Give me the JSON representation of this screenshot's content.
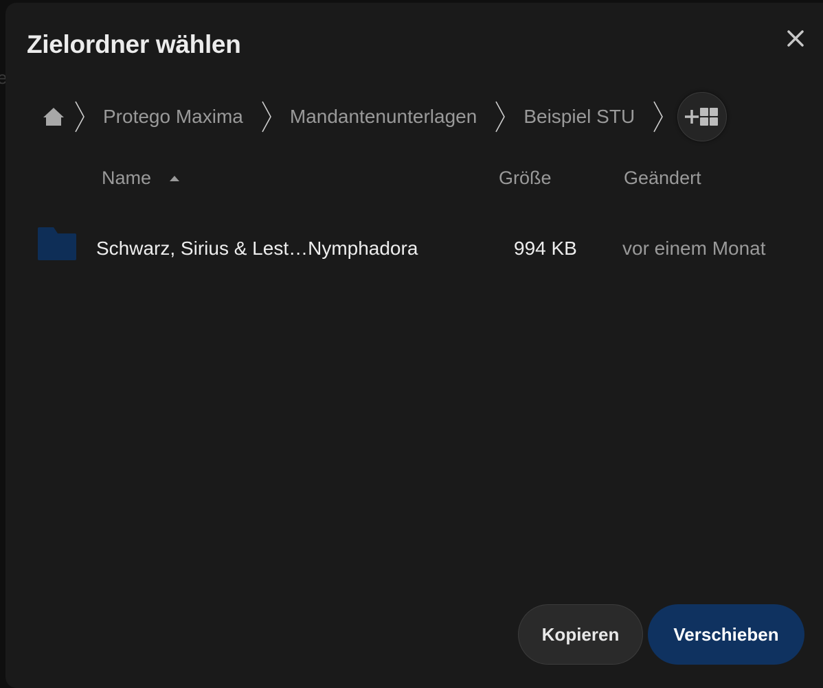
{
  "background": {
    "partial_text": "e"
  },
  "dialog": {
    "title": "Zielordner wählen",
    "close_icon": "close-icon"
  },
  "breadcrumb": {
    "home_icon": "home-icon",
    "items": [
      {
        "label": "Protego Maxima"
      },
      {
        "label": "Mandantenunterlagen"
      },
      {
        "label": "Beispiel STU"
      }
    ],
    "add_icon": "add-folder-icon"
  },
  "table": {
    "headers": {
      "name": "Name",
      "size": "Größe",
      "modified": "Geändert"
    },
    "sort": {
      "column": "name",
      "direction": "ascending"
    },
    "rows": [
      {
        "icon": "folder-icon",
        "name": "Schwarz, Sirius & Lest…Nymphadora",
        "size": "994 KB",
        "modified": "vor einem Monat"
      }
    ]
  },
  "actions": {
    "copy_label": "Kopieren",
    "move_label": "Verschieben"
  },
  "colors": {
    "dialog_bg": "#1a1a1a",
    "primary": "#0f3260",
    "folder": "#0e2e57"
  }
}
